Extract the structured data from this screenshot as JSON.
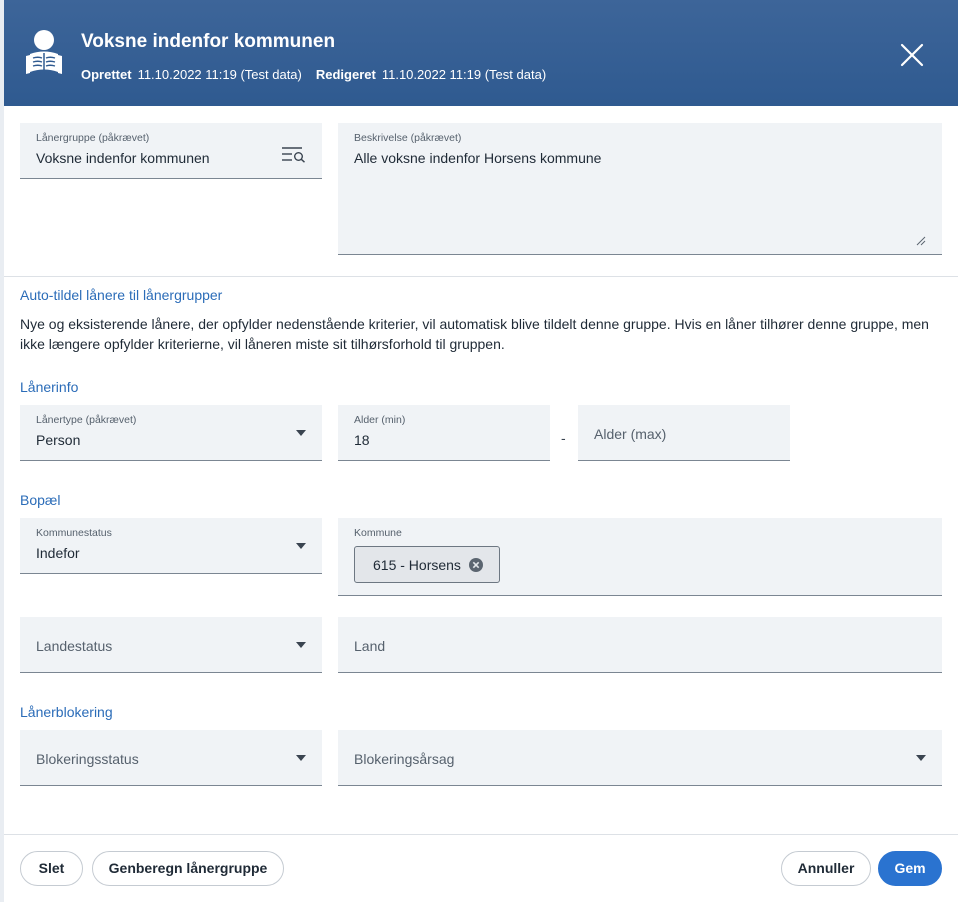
{
  "header": {
    "title": "Voksne indenfor kommunen",
    "created_label": "Oprettet",
    "created_value": "11.10.2022 11:19 (Test data)",
    "edited_label": "Redigeret",
    "edited_value": "11.10.2022 11:19 (Test data)",
    "icon": "reader-icon",
    "close_icon": "close-icon"
  },
  "form": {
    "loan_group": {
      "label": "Lånergruppe (påkrævet)",
      "value": "Voksne indenfor kommunen",
      "icon": "lookup-icon"
    },
    "description": {
      "label": "Beskrivelse (påkrævet)",
      "value": "Alle voksne indenfor Horsens kommune"
    }
  },
  "auto_assign": {
    "heading": "Auto-tildel lånere til lånergrupper",
    "text": "Nye og eksisterende lånere, der opfylder nedenstående kriterier, vil automatisk blive tildelt denne gruppe. Hvis en låner tilhører denne gruppe, men ikke længere opfylder kriterierne, vil låneren miste sit tilhørsforhold til gruppen."
  },
  "borrower_info": {
    "heading": "Lånerinfo",
    "type": {
      "label": "Lånertype (påkrævet)",
      "value": "Person"
    },
    "age_min": {
      "label": "Alder (min)",
      "value": "18"
    },
    "dash": "-",
    "age_max": {
      "placeholder": "Alder (max)"
    }
  },
  "residence": {
    "heading": "Bopæl",
    "municipality_status": {
      "label": "Kommunestatus",
      "value": "Indefor"
    },
    "municipality": {
      "label": "Kommune",
      "chip": "615 - Horsens"
    },
    "country_status": {
      "placeholder": "Landestatus"
    },
    "country": {
      "placeholder": "Land"
    }
  },
  "blocking": {
    "heading": "Lånerblokering",
    "status": {
      "placeholder": "Blokeringsstatus"
    },
    "reason": {
      "placeholder": "Blokeringsårsag"
    }
  },
  "footer": {
    "delete": "Slet",
    "recalculate": "Genberegn lånergruppe",
    "cancel": "Annuller",
    "save": "Gem"
  },
  "colors": {
    "header": "#2f5a90",
    "accent": "#2b6cb8",
    "primary_button": "#2a73d0",
    "field_bg": "#f0f3f6"
  }
}
